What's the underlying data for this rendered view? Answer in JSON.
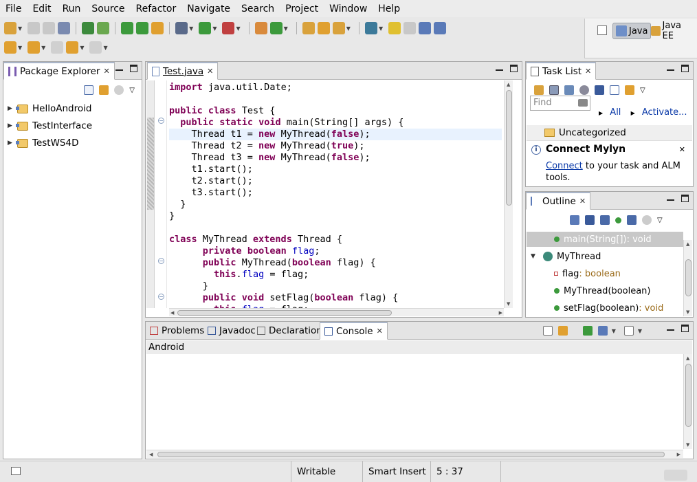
{
  "menu": [
    "File",
    "Edit",
    "Run",
    "Source",
    "Refactor",
    "Navigate",
    "Search",
    "Project",
    "Window",
    "Help"
  ],
  "perspectives": [
    {
      "label": "Java",
      "icon": "java-perspective-icon",
      "active": true
    },
    {
      "label": "Java EE",
      "icon": "javaee-perspective-icon",
      "active": false
    }
  ],
  "package_explorer": {
    "title": "Package Explorer",
    "projects": [
      "HelloAndroid",
      "TestInterface",
      "TestWS4D"
    ]
  },
  "editor": {
    "tab": "Test.java",
    "lines": [
      [
        [
          "k",
          "import"
        ],
        [
          "t",
          " java.util.Date;"
        ]
      ],
      [],
      [
        [
          "k",
          "public"
        ],
        [
          "t",
          " "
        ],
        [
          "k",
          "class"
        ],
        [
          "t",
          " Test {"
        ]
      ],
      [
        [
          "t",
          "  "
        ],
        [
          "k",
          "public"
        ],
        [
          "t",
          " "
        ],
        [
          "k",
          "static"
        ],
        [
          "t",
          " "
        ],
        [
          "k",
          "void"
        ],
        [
          "t",
          " main(String[] args) {"
        ]
      ],
      [
        [
          "t",
          "    Thread t1 = "
        ],
        [
          "k",
          "new"
        ],
        [
          "t",
          " MyThread("
        ],
        [
          "k",
          "false"
        ],
        [
          "t",
          ");"
        ]
      ],
      [
        [
          "t",
          "    Thread t2 = "
        ],
        [
          "k",
          "new"
        ],
        [
          "t",
          " MyThread("
        ],
        [
          "k",
          "true"
        ],
        [
          "t",
          ");"
        ]
      ],
      [
        [
          "t",
          "    Thread t3 = "
        ],
        [
          "k",
          "new"
        ],
        [
          "t",
          " MyThread("
        ],
        [
          "k",
          "false"
        ],
        [
          "t",
          ");"
        ]
      ],
      [
        [
          "t",
          "    t1.start();"
        ]
      ],
      [
        [
          "t",
          "    t2.start();"
        ]
      ],
      [
        [
          "t",
          "    t3.start();"
        ]
      ],
      [
        [
          "t",
          "  }"
        ]
      ],
      [
        [
          "t",
          "}"
        ]
      ],
      [],
      [
        [
          "k",
          "class"
        ],
        [
          "t",
          " MyThread "
        ],
        [
          "k",
          "extends"
        ],
        [
          "t",
          " Thread {"
        ]
      ],
      [
        [
          "t",
          "      "
        ],
        [
          "k",
          "private"
        ],
        [
          "t",
          " "
        ],
        [
          "k",
          "boolean"
        ],
        [
          "t",
          " "
        ],
        [
          "f",
          "flag"
        ],
        [
          "t",
          ";"
        ]
      ],
      [
        [
          "t",
          "      "
        ],
        [
          "k",
          "public"
        ],
        [
          "t",
          " MyThread("
        ],
        [
          "k",
          "boolean"
        ],
        [
          "t",
          " flag) {"
        ]
      ],
      [
        [
          "t",
          "        "
        ],
        [
          "k",
          "this"
        ],
        [
          "t",
          "."
        ],
        [
          "f",
          "flag"
        ],
        [
          "t",
          " = flag;"
        ]
      ],
      [
        [
          "t",
          "      }"
        ]
      ],
      [
        [
          "t",
          "      "
        ],
        [
          "k",
          "public"
        ],
        [
          "t",
          " "
        ],
        [
          "k",
          "void"
        ],
        [
          "t",
          " setFlag("
        ],
        [
          "k",
          "boolean"
        ],
        [
          "t",
          " flag) {"
        ]
      ],
      [
        [
          "t",
          "        "
        ],
        [
          "k",
          "this"
        ],
        [
          "t",
          "."
        ],
        [
          "f",
          "flag"
        ],
        [
          "t",
          " = flag;"
        ]
      ]
    ]
  },
  "task_list": {
    "title": "Task List",
    "find_placeholder": "Find",
    "all_label": "All",
    "activate_label": "Activate...",
    "category": "Uncategorized",
    "mylyn_title": "Connect Mylyn",
    "mylyn_link": "Connect",
    "mylyn_text_1": " to your task and ALM",
    "mylyn_text_2": "tools."
  },
  "outline": {
    "title": "Outline",
    "items": [
      {
        "label": "main(String[])",
        "type": " : void",
        "indent": 1,
        "kind": "static-method",
        "selected": true
      },
      {
        "label": "MyThread",
        "type": "",
        "indent": 0,
        "kind": "class",
        "selected": false
      },
      {
        "label": "flag",
        "type": " : boolean",
        "indent": 1,
        "kind": "field",
        "selected": false
      },
      {
        "label": "MyThread(boolean)",
        "type": "",
        "indent": 1,
        "kind": "constructor",
        "selected": false
      },
      {
        "label": "setFlag(boolean)",
        "type": " : void",
        "indent": 1,
        "kind": "method",
        "selected": false
      }
    ]
  },
  "bottom": {
    "tabs": [
      "Problems",
      "Javadoc",
      "Declaration",
      "Console"
    ],
    "active_tab": "Console",
    "console_name": "Android"
  },
  "status": {
    "writable": "Writable",
    "insert_mode": "Smart Insert",
    "position": "5 : 37"
  },
  "colors": {
    "keyword": "#7f0055",
    "field": "#0000c0",
    "current_line": "#e8f2fe",
    "link": "#0b3aa8"
  }
}
